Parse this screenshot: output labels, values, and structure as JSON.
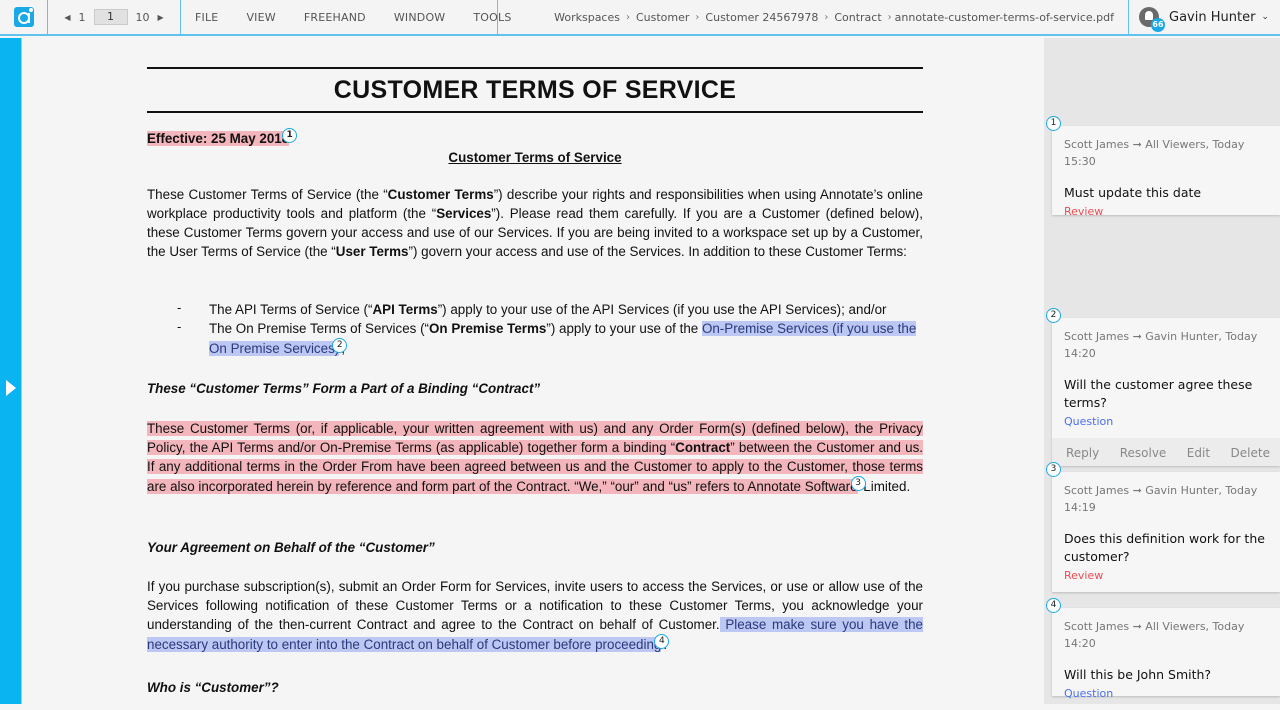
{
  "topbar": {
    "pager": {
      "current": "1",
      "input_value": "1",
      "total": "10"
    },
    "menu": [
      "FILE",
      "VIEW",
      "FREEHAND",
      "WINDOW",
      "TOOLS"
    ],
    "breadcrumb": [
      "Workspaces",
      "Customer",
      "Customer 24567978",
      "Contract",
      "annotate-customer-terms-of-service.pdf"
    ],
    "breadcrumb_sep": "›",
    "notifications_count": "66",
    "user_name": "Gavin Hunter"
  },
  "document": {
    "title": "CUSTOMER TERMS OF SERVICE",
    "effective": "Effective: 25 May 2018",
    "subtitle": "Customer Terms of Service",
    "intro": {
      "t1": "These Customer Terms of Service (the “",
      "b1": "Customer Terms",
      "t2": "”) describe your rights and responsibilities when using Annotate’s online workplace productivity tools and platform (the “",
      "b2": "Services",
      "t3": "”). Please read them carefully. If you are a Customer (defined below), these Customer Terms govern your access and use of our Services. If you are being invited to a workspace set up by a Customer, the User Terms of Service (the “",
      "b3": "User Terms",
      "t4": "”) govern your access and use of the Services. In addition to these Customer Terms:"
    },
    "bullet_symbol": "-",
    "bullet1": {
      "t1": "The API Terms of Service (“",
      "b1": "API Terms",
      "t2": "”) apply to your use of the API Services (if you use the API Services); and/or"
    },
    "bullet2": {
      "t1": "The On Premise Terms of Services (“",
      "b1": "On Premise Terms",
      "t2": "”) apply to your use of the ",
      "hl": "On-Premise Services (if you use the On Premise Services)",
      "t3": ";"
    },
    "heading1": "These “Customer Terms” Form a Part of a Binding “Contract”",
    "contract": {
      "t1": "These Customer Terms (or, if applicable, your written agreement with us) and any Order Form(s) (defined below), the Privacy Policy, the API Terms and/or On-Premise Terms (as applicable) together form a binding “",
      "b1": "Contract",
      "t2": "” between the Customer and us. If any additional terms in the Order From have been agreed between us and the Customer to apply to the Customer, those terms are also incorporated herein by reference and form part of the Contract. “We,” “our” and “us” refers to Annotate Software",
      "t3": " Limited."
    },
    "heading2": "Your Agreement on Behalf of the “Customer”",
    "agreement": {
      "t1": "If you purchase subscription(s), submit an Order Form for Services, invite users to access the Services, or use or allow use of the Services following notification of these Customer Terms or a notification to these Customer Terms, you acknowledge your understanding of the then-current Contract and agree to the Contract on behalf of Customer.",
      "hl": " Please make sure you have the necessary authority to enter into the Contract on behalf of Customer before proceeding",
      "t2": "."
    },
    "heading3": "Who is “Customer”?",
    "markers": [
      "1",
      "2",
      "3",
      "4"
    ]
  },
  "comments": [
    {
      "num": "1",
      "meta": "Scott James ➞ All Viewers, Today 15:30",
      "body": "Must update this date",
      "tag": "Review",
      "tag_type": "review"
    },
    {
      "num": "2",
      "meta": "Scott James ➞ Gavin Hunter, Today 14:20",
      "body": "Will the customer agree these terms?",
      "tag": "Question",
      "tag_type": "question",
      "actions": [
        "Reply",
        "Resolve",
        "Edit",
        "Delete"
      ]
    },
    {
      "num": "3",
      "meta": "Scott James ➞ Gavin Hunter, Today 14:19",
      "body": "Does this definition work for the customer?",
      "tag": "Review",
      "tag_type": "review"
    },
    {
      "num": "4",
      "meta": "Scott James ➞ All Viewers, Today 14:20",
      "body": "Will this be John Smith?",
      "tag": "Question",
      "tag_type": "question"
    }
  ],
  "colors": {
    "accent": "#0ab4f1",
    "highlight_red": "#f0828c",
    "highlight_blue": "#8ca0f0",
    "tag_review": "#ee4b52",
    "tag_question": "#4a6ff0"
  }
}
